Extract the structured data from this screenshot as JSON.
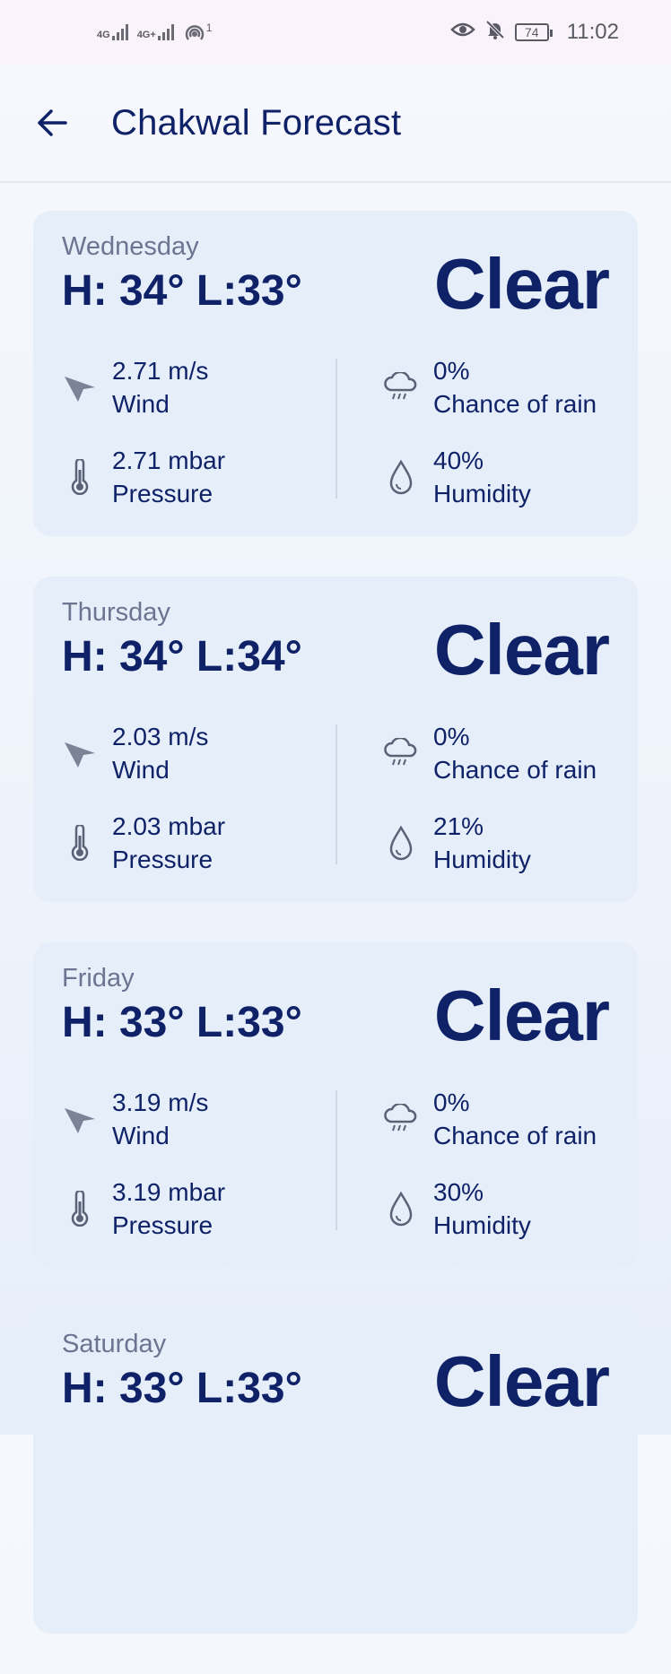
{
  "status_bar": {
    "net1": "4G",
    "net2": "4G+",
    "hotspot_badge": "1",
    "battery": "74",
    "time": "11:02"
  },
  "header": {
    "title": "Chakwal Forecast"
  },
  "forecast": [
    {
      "day": "Wednesday",
      "hl": "H: 34° L:33°",
      "condition": "Clear",
      "wind": "2.71 m/s",
      "wind_label": "Wind",
      "pressure": "2.71 mbar",
      "pressure_label": "Pressure",
      "rain": "0%",
      "rain_label": "Chance of rain",
      "humidity": "40%",
      "humidity_label": "Humidity"
    },
    {
      "day": "Thursday",
      "hl": "H: 34° L:34°",
      "condition": "Clear",
      "wind": "2.03 m/s",
      "wind_label": "Wind",
      "pressure": "2.03 mbar",
      "pressure_label": "Pressure",
      "rain": "0%",
      "rain_label": "Chance of rain",
      "humidity": "21%",
      "humidity_label": "Humidity"
    },
    {
      "day": "Friday",
      "hl": "H: 33° L:33°",
      "condition": "Clear",
      "wind": "3.19 m/s",
      "wind_label": "Wind",
      "pressure": "3.19 mbar",
      "pressure_label": "Pressure",
      "rain": "0%",
      "rain_label": "Chance of rain",
      "humidity": "30%",
      "humidity_label": "Humidity"
    },
    {
      "day": "Saturday",
      "hl": "H: 33° L:33°",
      "condition": "Clear",
      "wind": "",
      "wind_label": "",
      "pressure": "",
      "pressure_label": "",
      "rain": "",
      "rain_label": "",
      "humidity": "",
      "humidity_label": ""
    }
  ],
  "colors": {
    "accent": "#0f2167",
    "card_bg": "#e5eef9",
    "muted_text": "#6b7591"
  },
  "icons": [
    "back-arrow-icon",
    "wind-direction-icon",
    "thermometer-icon",
    "rain-cloud-icon",
    "droplet-icon"
  ]
}
